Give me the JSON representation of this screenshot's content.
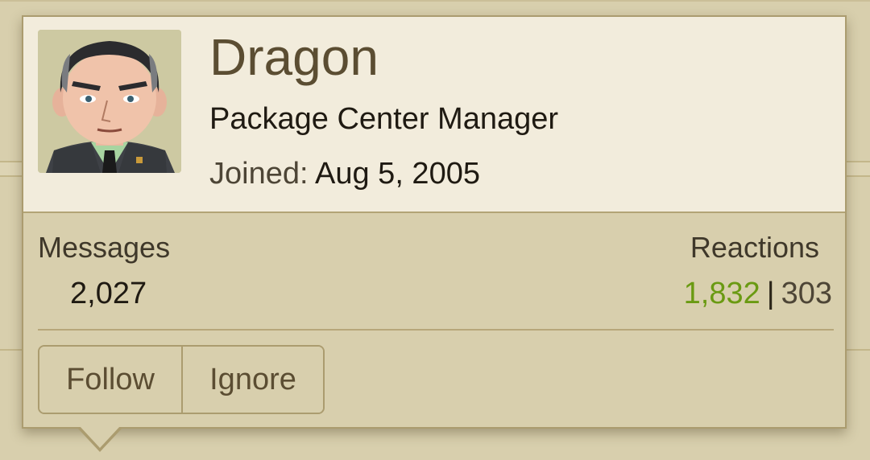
{
  "profile": {
    "username": "Dragon",
    "title": "Package Center Manager",
    "joined_label": "Joined:",
    "joined_date": "Aug 5, 2005",
    "avatar_icon": "cartoon-man-avatar"
  },
  "stats": {
    "messages_label": "Messages",
    "messages_value": "2,027",
    "reactions_label": "Reactions",
    "reactions_positive": "1,832",
    "reactions_separator": "|",
    "reactions_negative": "303"
  },
  "actions": {
    "follow_label": "Follow",
    "ignore_label": "Ignore"
  },
  "colors": {
    "header_bg": "#f2ecdc",
    "card_bg": "#d8cfad",
    "border": "#ab9c6f",
    "username": "#5b4d32",
    "reactions_positive": "#6a9a12"
  }
}
